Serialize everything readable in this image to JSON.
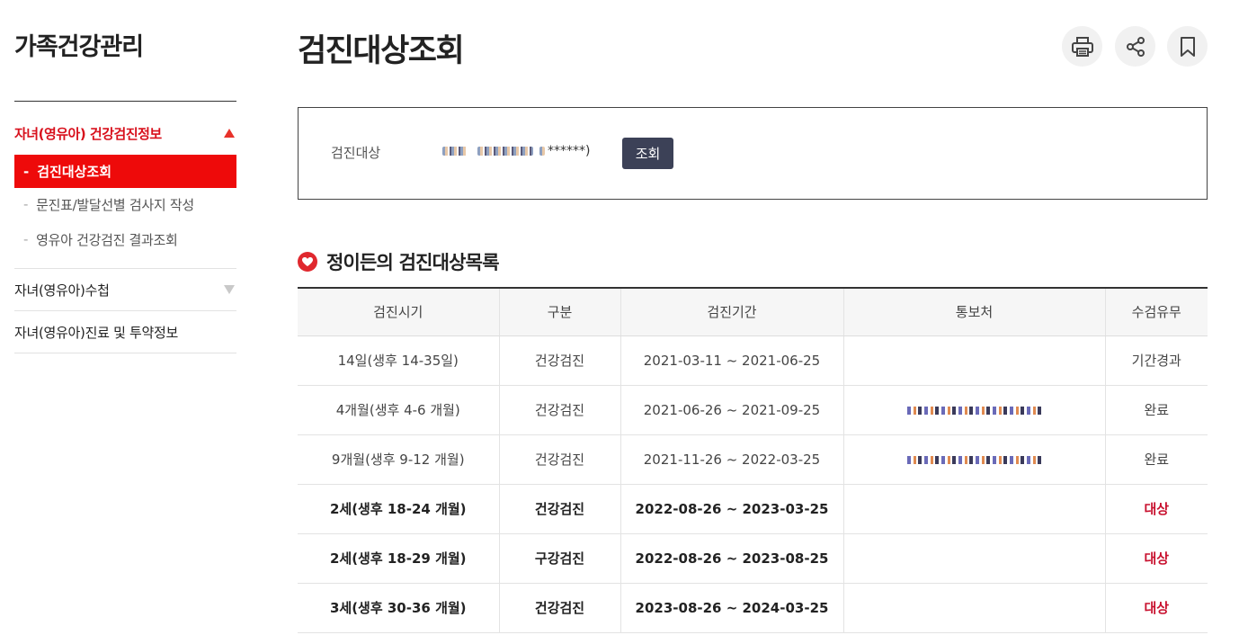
{
  "sidebar": {
    "title": "가족건강관리",
    "active_menu": "자녀(영유아) 건강검진정보",
    "sub_items": [
      {
        "dash": "-",
        "label": "검진대상조회",
        "active": true
      },
      {
        "dash": "-",
        "label": "문진표/발달선별 검사지 작성",
        "active": false
      },
      {
        "dash": "-",
        "label": "영유아 건강검진 결과조회",
        "active": false
      }
    ],
    "menu_items": [
      {
        "label": "자녀(영유아)수첩"
      },
      {
        "label": "자녀(영유아)진료 및 투약정보"
      }
    ]
  },
  "page": {
    "title": "검진대상조회",
    "actions": [
      {
        "icon": "print-icon"
      },
      {
        "icon": "share-icon"
      },
      {
        "icon": "bookmark-icon"
      }
    ]
  },
  "search": {
    "label": "검진대상",
    "masked_suffix": "******)",
    "button": "조회"
  },
  "list": {
    "heading": "정이든의 검진대상목록",
    "columns": [
      "검진시기",
      "구분",
      "검진기간",
      "통보처",
      "수검유무"
    ],
    "rows": [
      {
        "timing": "14일(생후 14-35일)",
        "type": "건강검진",
        "period": "2021-03-11 ~ 2021-06-25",
        "notice": "",
        "status": "기간경과"
      },
      {
        "timing": "4개월(생후 4-6 개월)",
        "type": "건강검진",
        "period": "2021-06-26 ~ 2021-09-25",
        "notice": "",
        "status": "완료"
      },
      {
        "timing": "9개월(생후 9-12 개월)",
        "type": "건강검진",
        "period": "2021-11-26 ~ 2022-03-25",
        "notice": "",
        "status": "완료"
      },
      {
        "timing": "2세(생후 18-24 개월)",
        "type": "건강검진",
        "period": "2022-08-26 ~ 2023-03-25",
        "notice": "",
        "status": "대상"
      },
      {
        "timing": "2세(생후 18-29 개월)",
        "type": "구강검진",
        "period": "2022-08-26 ~ 2023-08-25",
        "notice": "",
        "status": "대상"
      },
      {
        "timing": "3세(생후 30-36 개월)",
        "type": "건강검진",
        "period": "2023-08-26 ~ 2024-03-25",
        "notice": "",
        "status": "대상"
      }
    ]
  },
  "colors": {
    "accent_red": "#ee0a0a",
    "status_red": "#c8102e",
    "button_dark": "#3c4157"
  }
}
